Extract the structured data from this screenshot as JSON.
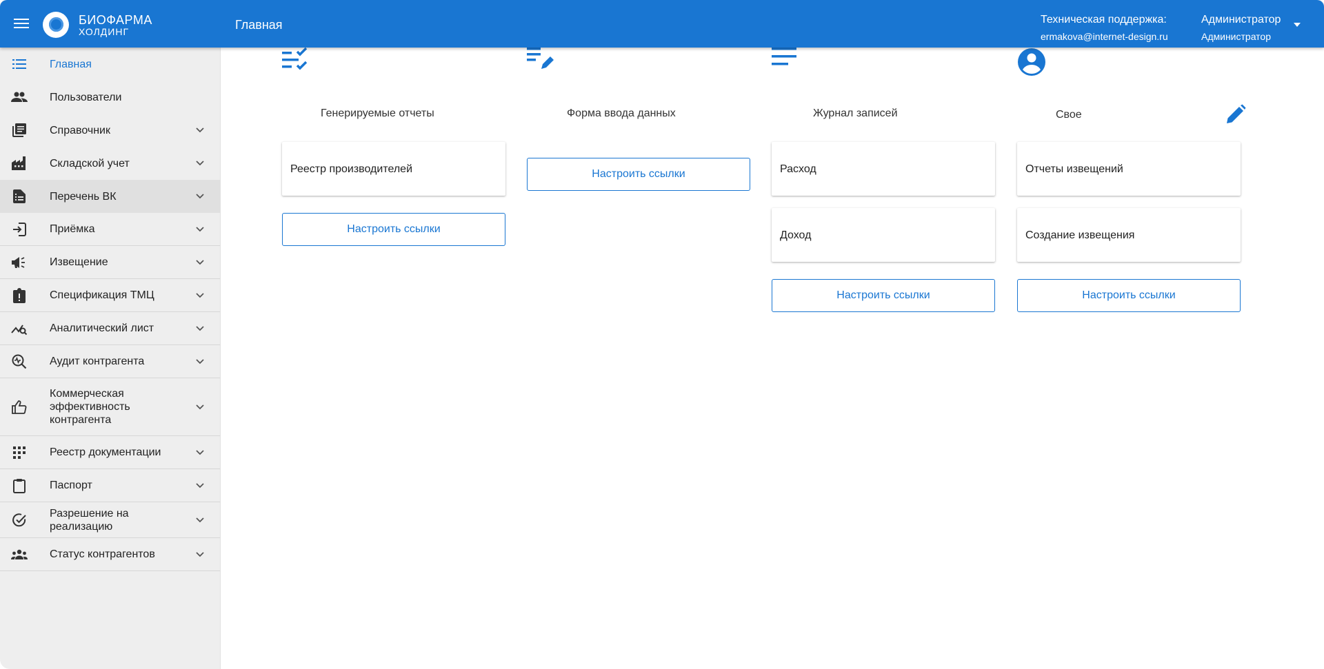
{
  "header": {
    "brand_line1": "БИОФАРМА",
    "brand_line2": "ХОЛДИНГ",
    "page_title": "Главная",
    "support_label": "Техническая поддержка:",
    "support_email": "ermakova@internet-design.ru",
    "user_name": "Администратор",
    "user_role": "Администратор",
    "accent_color": "#1976d2"
  },
  "sidebar": {
    "items": [
      {
        "label": "Главная",
        "icon": "list-icon",
        "expandable": false,
        "current": true
      },
      {
        "label": "Пользователи",
        "icon": "people-icon",
        "expandable": false
      },
      {
        "label": "Справочник",
        "icon": "library-icon",
        "expandable": true
      },
      {
        "label": "Складской учет",
        "icon": "factory-icon",
        "expandable": true
      },
      {
        "label": "Перечень ВК",
        "icon": "document-icon",
        "expandable": true,
        "highlighted": true
      },
      {
        "label": "Приёмка",
        "icon": "login-icon",
        "expandable": true
      },
      {
        "label": "Извещение",
        "icon": "campaign-icon",
        "expandable": true
      },
      {
        "label": "Спецификация ТМЦ",
        "icon": "clipboard-alert-icon",
        "expandable": true
      },
      {
        "label": "Аналитический лист",
        "icon": "query-stats-icon",
        "expandable": true
      },
      {
        "label": "Аудит контрагента",
        "icon": "audit-search-icon",
        "expandable": true
      },
      {
        "label": "Коммерческая эффективность контрагента",
        "icon": "thumb-up-icon",
        "expandable": true
      },
      {
        "label": "Реестр документации",
        "icon": "apps-icon",
        "expandable": true
      },
      {
        "label": "Паспорт",
        "icon": "clipboard-icon",
        "expandable": true
      },
      {
        "label": "Разрешение на реализацию",
        "icon": "check-circle-icon",
        "expandable": true
      },
      {
        "label": "Статус контрагентов",
        "icon": "groups-icon",
        "expandable": true
      }
    ]
  },
  "main": {
    "columns": [
      {
        "title": "Генерируемые отчеты",
        "icon": "checklist-icon",
        "cards": [
          "Реестр производителей"
        ],
        "button": "Настроить ссылки"
      },
      {
        "title": "Форма ввода данных",
        "icon": "edit-note-icon",
        "cards": [],
        "button": "Настроить ссылки"
      },
      {
        "title": "Журнал записей",
        "icon": "lines-icon",
        "cards": [
          "Расход",
          "Доход"
        ],
        "button": "Настроить ссылки"
      },
      {
        "title": "Свое",
        "icon": "account-circle-icon",
        "cards": [
          "Отчеты извещений",
          "Создание извещения"
        ],
        "button": "Настроить ссылки"
      }
    ],
    "edit_icon": "pencil-icon"
  }
}
